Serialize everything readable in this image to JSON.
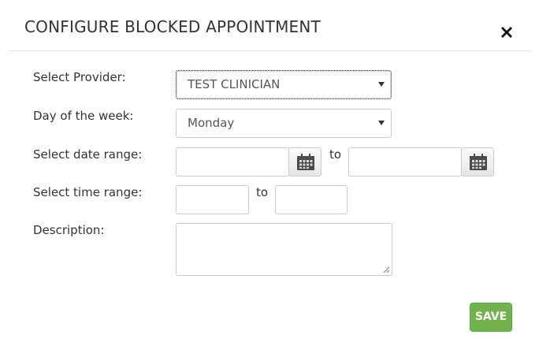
{
  "dialog": {
    "title": "CONFIGURE BLOCKED APPOINTMENT",
    "close_icon": "close-x-icon"
  },
  "form": {
    "provider": {
      "label": "Select Provider:",
      "value": "TEST CLINICIAN"
    },
    "day_of_week": {
      "label": "Day of the week:",
      "value": "Monday"
    },
    "date_range": {
      "label": "Select date range:",
      "start_value": "",
      "end_value": "",
      "separator": "to",
      "calendar_icon": "calendar-icon"
    },
    "time_range": {
      "label": "Select time range:",
      "start_value": "",
      "end_value": "",
      "separator": "to"
    },
    "description": {
      "label": "Description:",
      "value": ""
    }
  },
  "actions": {
    "save_label": "SAVE"
  },
  "colors": {
    "save_button": "#72b24a",
    "text": "#333333",
    "border": "#cccccc"
  }
}
